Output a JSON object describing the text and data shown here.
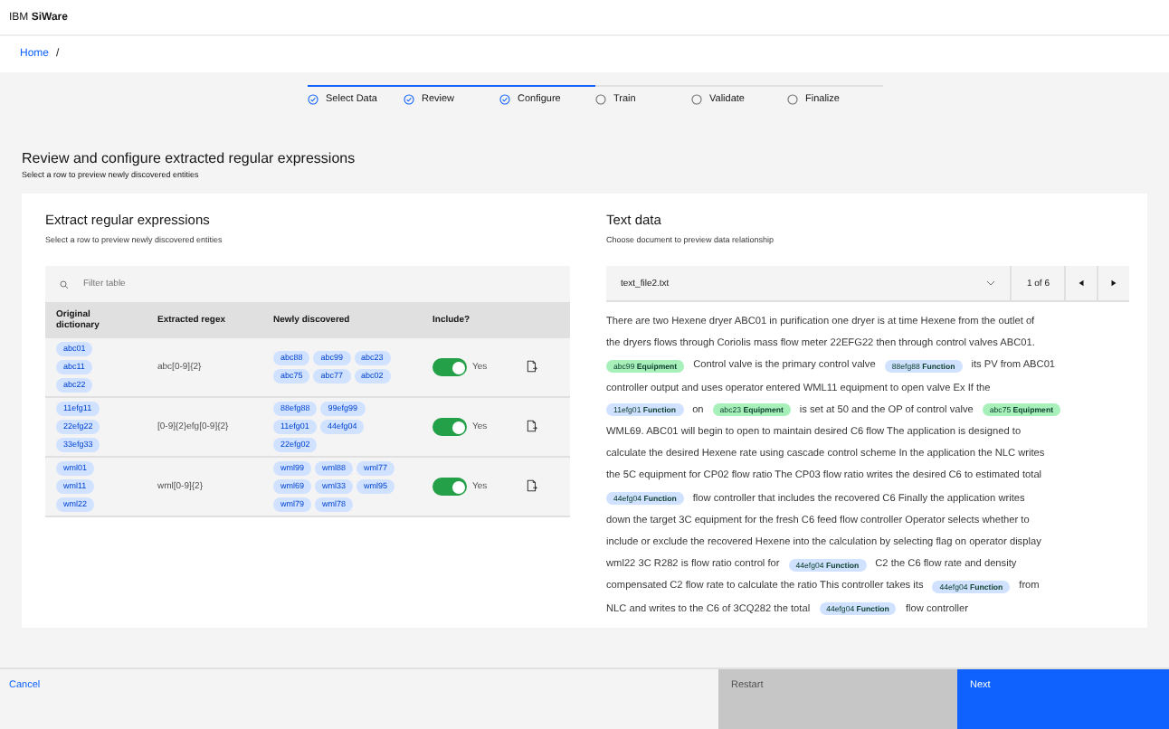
{
  "header": {
    "brand_prefix": "IBM",
    "brand_name": "SiWare"
  },
  "breadcrumb": [
    "Home",
    "/"
  ],
  "steps": [
    {
      "label": "Select Data",
      "complete": true
    },
    {
      "label": "Review",
      "complete": true
    },
    {
      "label": "Configure",
      "complete": true
    },
    {
      "label": "Train",
      "complete": false
    },
    {
      "label": "Validate",
      "complete": false
    },
    {
      "label": "Finalize",
      "complete": false
    }
  ],
  "page": {
    "title": "Review and configure extracted regular expressions",
    "subtitle": "Select a row to preview newly discovered entities"
  },
  "left": {
    "title": "Extract regular expressions",
    "subtitle": "Select a row to preview newly discovered entities",
    "filter_placeholder": "Filter table",
    "columns": [
      "Original dictionary",
      "Extracted regex",
      "Newly discovered",
      "Include?"
    ],
    "rows": [
      {
        "original": [
          "abc01",
          "abc11",
          "abc22"
        ],
        "regex": "abc[0-9]{2}",
        "discovered": [
          "abc88",
          "abc99",
          "abc23",
          "abc75",
          "abc77",
          "abc02"
        ],
        "include": true,
        "include_label": "Yes"
      },
      {
        "original": [
          "11efg11",
          "22efg22",
          "33efg33"
        ],
        "regex": "[0-9]{2}efg[0-9]{2}",
        "discovered": [
          "88efg88",
          "99efg99",
          "11efg01",
          "44efg04",
          "22efg02"
        ],
        "include": true,
        "include_label": "Yes"
      },
      {
        "original": [
          "wml01",
          "wml11",
          "wml22"
        ],
        "regex": "wml[0-9]{2}",
        "discovered": [
          "wml99",
          "wml88",
          "wml77",
          "wml69",
          "wml33",
          "wml95",
          "wml79",
          "wml78"
        ],
        "include": true,
        "include_label": "Yes"
      }
    ]
  },
  "right": {
    "title": "Text data",
    "subtitle": "Choose document to preview data relationship",
    "document": "text_file2.txt",
    "pager": "1 of 6",
    "lines": [
      [
        {
          "kind": "text",
          "text": "There are two Hexene dryer ABC01 in purification one dryer is at time Hexene from the outlet of"
        }
      ],
      [
        {
          "kind": "text",
          "text": "the dryers flows through Coriolis mass flow meter 22EFG22 then through control valves ABC01."
        }
      ],
      [
        {
          "kind": "tag",
          "text": "abc99",
          "label": "Equipment",
          "color": "#a7f0ba"
        },
        {
          "kind": "text",
          "text": "Control valve is the primary control valve"
        },
        {
          "kind": "tag",
          "text": "88efg88",
          "label": "Function",
          "color": "#d0e2ff"
        },
        {
          "kind": "text",
          "text": "its PV from ABC01"
        }
      ],
      [
        {
          "kind": "text",
          "text": "controller output and uses operator entered WML11 equipment to open valve Ex If the"
        }
      ],
      [
        {
          "kind": "tag",
          "text": "11efg01",
          "label": "Function",
          "color": "#d0e2ff"
        },
        {
          "kind": "text",
          "text": "on"
        },
        {
          "kind": "tag",
          "text": "abc23",
          "label": "Equipment",
          "color": "#a7f0ba"
        },
        {
          "kind": "text",
          "text": "is set at 50 and the OP of control valve"
        },
        {
          "kind": "tag",
          "text": "abc75",
          "label": "Equipment",
          "color": "#a7f0ba"
        }
      ],
      [
        {
          "kind": "text",
          "text": "WML69. ABC01 will begin to open to maintain desired C6 flow The application is designed to"
        }
      ],
      [
        {
          "kind": "text",
          "text": "calculate the desired Hexene rate using cascade control scheme In the application the NLC writes"
        }
      ],
      [
        {
          "kind": "text",
          "text": "the 5C equipment for CP02 flow ratio The CP03 flow ratio writes the desired C6 to estimated total"
        }
      ],
      [
        {
          "kind": "tag",
          "text": "44efg04",
          "label": "Function",
          "color": "#d0e2ff"
        },
        {
          "kind": "text",
          "text": "flow controller that includes the recovered C6 Finally the application writes"
        }
      ],
      [
        {
          "kind": "text",
          "text": "down the target 3C equipment for the fresh C6 feed flow controller Operator selects whether to"
        }
      ],
      [
        {
          "kind": "text",
          "text": "include or exclude the recovered Hexene into the calculation by selecting flag on operator display"
        }
      ],
      [
        {
          "kind": "text",
          "text": "wml22 3C R282 is flow ratio control for"
        },
        {
          "kind": "tag",
          "text": "44efg04",
          "label": "Function",
          "color": "#d0e2ff"
        },
        {
          "kind": "text",
          "text": "C2 the C6 flow rate and density"
        }
      ],
      [
        {
          "kind": "text",
          "text": "compensated C2 flow rate to calculate the ratio This controller takes its"
        },
        {
          "kind": "tag",
          "text": "44efg04",
          "label": "Function",
          "color": "#d0e2ff"
        },
        {
          "kind": "text",
          "text": "from"
        }
      ],
      [
        {
          "kind": "text",
          "text": "NLC and writes to the C6 of 3CQ282 the total"
        },
        {
          "kind": "tag",
          "text": "44efg04",
          "label": "Function",
          "color": "#d0e2ff"
        },
        {
          "kind": "text",
          "text": "flow controller"
        }
      ]
    ]
  },
  "footer": {
    "cancel": "Cancel",
    "restart": "Restart",
    "next": "Next"
  }
}
